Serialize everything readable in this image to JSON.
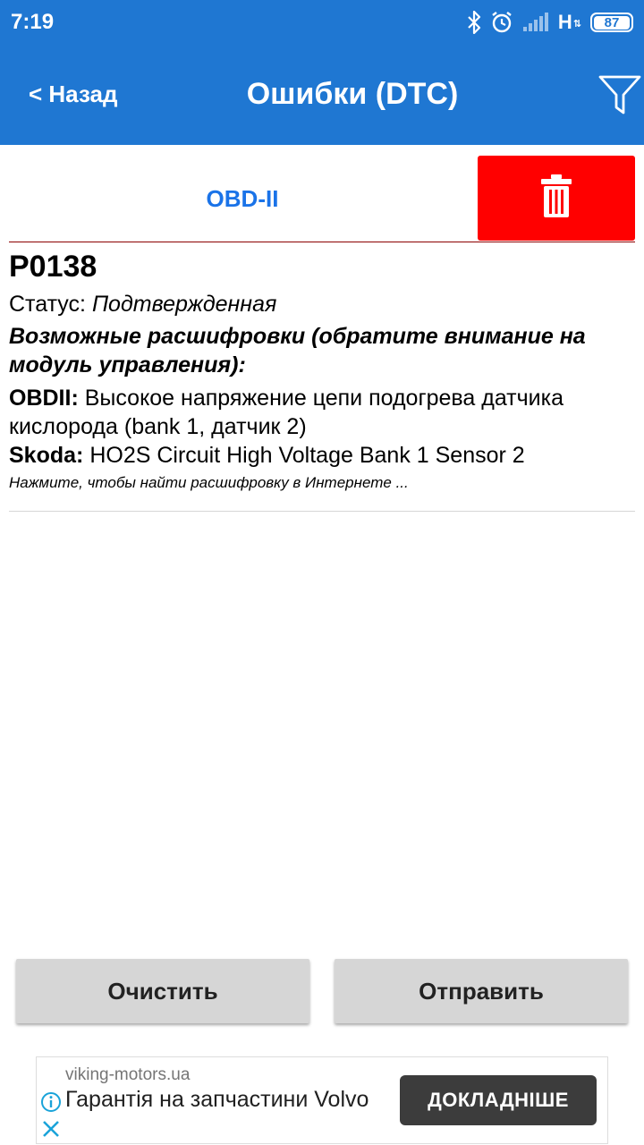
{
  "status_bar": {
    "time": "7:19",
    "network_type": "H",
    "network_arrows": "⇅",
    "battery": "87"
  },
  "app_bar": {
    "back_label": "< Назад",
    "title": "Ошибки (DTC)"
  },
  "tabs": {
    "obd_label": "OBD-II"
  },
  "dtc": {
    "code": "P0138",
    "status_label": "Статус:",
    "status_value": "Подтвержденная",
    "decodings_heading": "Возможные расшифровки (обратите внимание на модуль управления):",
    "decodings": [
      {
        "module": "OBDII:",
        "text": "Высокое напряжение цепи подогрева датчика кислорода (bank 1, датчик 2)"
      },
      {
        "module": "Skoda:",
        "text": "HO2S Circuit High Voltage Bank 1 Sensor 2"
      }
    ],
    "search_hint": "Нажмите, чтобы найти расшифровку в Интернете ..."
  },
  "buttons": {
    "clear": "Очистить",
    "send": "Отправить"
  },
  "ad": {
    "domain": "viking-motors.ua",
    "text": "Гарантія на запчастини Volvo",
    "cta": "ДОКЛАДНІШЕ"
  },
  "colors": {
    "app_bar": "#1f77d2",
    "tab_text": "#1a73e8",
    "delete": "#ff0000",
    "button_bg": "#d6d6d6",
    "ad_cta": "#3c3c3c"
  },
  "icons": {
    "filter": "filter-icon",
    "delete": "trash-icon",
    "bluetooth": "bluetooth-icon",
    "alarm": "alarm-icon",
    "signal": "signal-icon",
    "ad_info": "info-icon",
    "ad_close": "close-icon"
  }
}
